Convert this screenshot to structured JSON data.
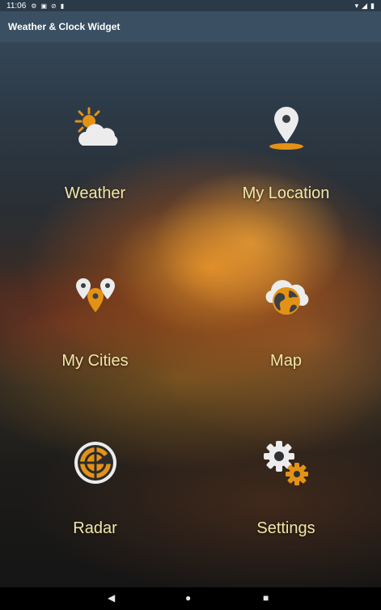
{
  "status_bar": {
    "time": "11:06",
    "left_icons": [
      "gear-icon",
      "notification-icon",
      "sim-icon",
      "sd-card-icon"
    ],
    "right_icons": [
      "wifi-icon",
      "signal-icon",
      "battery-icon"
    ]
  },
  "app_bar": {
    "title": "Weather & Clock Widget"
  },
  "tiles": [
    {
      "label": "Weather",
      "icon": "sun-cloud-icon"
    },
    {
      "label": "My Location",
      "icon": "location-pin-icon"
    },
    {
      "label": "My Cities",
      "icon": "city-pins-icon"
    },
    {
      "label": "Map",
      "icon": "globe-cloud-icon"
    },
    {
      "label": "Radar",
      "icon": "radar-icon"
    },
    {
      "label": "Settings",
      "icon": "gears-icon"
    }
  ],
  "colors": {
    "accent_orange": "#e39216",
    "label_yellow": "#f2e7a6",
    "app_bar": "#3a4f61",
    "status_bar": "#2a3a49"
  },
  "nav_bar": {
    "buttons": [
      "back-icon",
      "home-icon",
      "recents-icon"
    ]
  }
}
